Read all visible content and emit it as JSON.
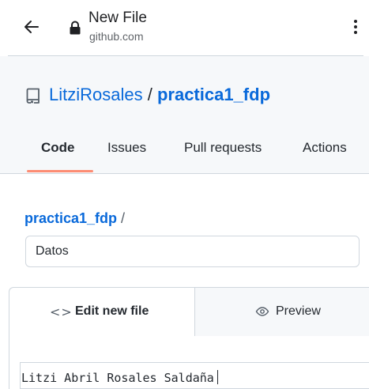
{
  "browser": {
    "page_title": "New File",
    "url": "github.com",
    "icons": {
      "back": "arrow-left-icon",
      "lock": "lock-icon",
      "menu": "more-vertical-icon"
    }
  },
  "repo": {
    "owner": "LitziRosales",
    "separator": " / ",
    "name": "practica1_fdp",
    "icon": "repo-icon"
  },
  "nav_tabs": [
    {
      "label": "Code",
      "selected": true
    },
    {
      "label": "Issues",
      "selected": false
    },
    {
      "label": "Pull requests",
      "selected": false
    },
    {
      "label": "Actions",
      "selected": false
    }
  ],
  "breadcrumb": {
    "repo": "practica1_fdp",
    "separator": " /"
  },
  "filename_input": {
    "value": "Datos"
  },
  "editor": {
    "tabs": [
      {
        "icon": "<>",
        "label": "Edit new file",
        "selected": true
      },
      {
        "icon": "eye-icon",
        "label": "Preview",
        "selected": false
      }
    ],
    "content": "Litzi Abril Rosales Saldaña"
  },
  "colors": {
    "link": "#0969da",
    "tab_underline": "#fd8c73",
    "header_bg": "#f6f8fa",
    "border": "#d0d7de"
  }
}
